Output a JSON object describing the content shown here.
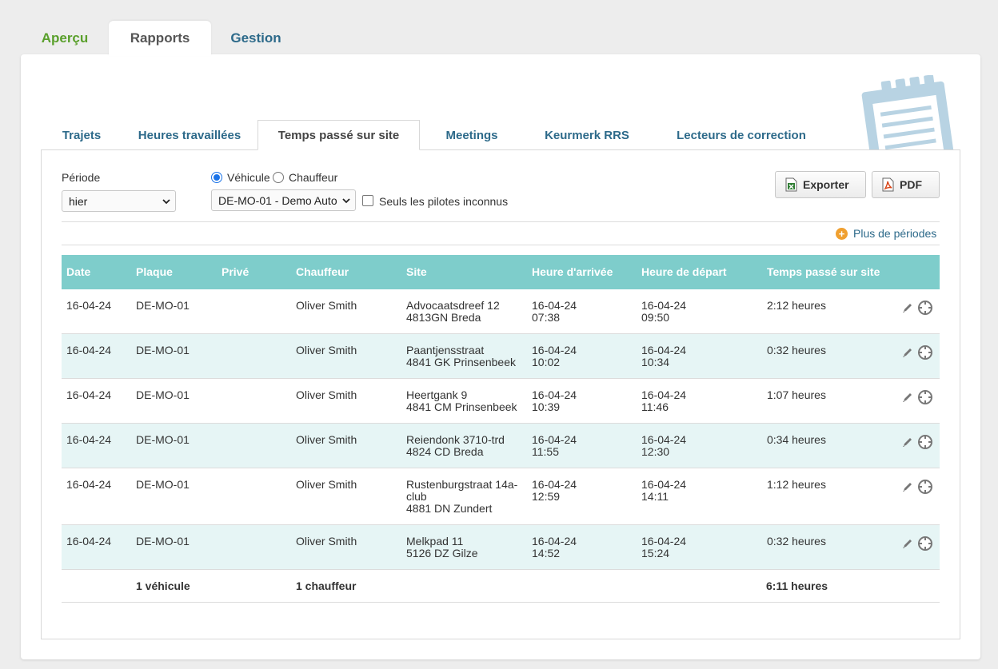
{
  "top_tabs": [
    {
      "label": "Aperçu"
    },
    {
      "label": "Rapports"
    },
    {
      "label": "Gestion"
    }
  ],
  "sub_tabs": [
    {
      "label": "Trajets"
    },
    {
      "label": "Heures travaillées"
    },
    {
      "label": "Temps passé sur site"
    },
    {
      "label": "Meetings"
    },
    {
      "label": "Keurmerk RRS"
    },
    {
      "label": "Lecteurs de correction"
    }
  ],
  "filters": {
    "period_label": "Période",
    "period_value": "hier",
    "radio_vehicle": "Véhicule",
    "radio_driver": "Chauffeur",
    "vehicle_value": "DE-MO-01 - Demo Auto",
    "unknown_drivers_label": "Seuls les pilotes inconnus"
  },
  "buttons": {
    "export": "Exporter",
    "pdf": "PDF"
  },
  "more_periods": "Plus de périodes",
  "table": {
    "headers": [
      "Date",
      "Plaque",
      "Privé",
      "Chauffeur",
      "Site",
      "Heure d'arrivée",
      "Heure de départ",
      "Temps passé sur site"
    ],
    "rows": [
      {
        "date": "16-04-24",
        "plate": "DE-MO-01",
        "private": "",
        "driver": "Oliver Smith",
        "site1": "Advocaatsdreef 12",
        "site2": "4813GN Breda",
        "site3": "",
        "arr_date": "16-04-24",
        "arr_time": "07:38",
        "dep_date": "16-04-24",
        "dep_time": "09:50",
        "duration": "2:12 heures"
      },
      {
        "date": "16-04-24",
        "plate": "DE-MO-01",
        "private": "",
        "driver": "Oliver Smith",
        "site1": "Paantjensstraat",
        "site2": "4841 GK Prinsenbeek",
        "site3": "",
        "arr_date": "16-04-24",
        "arr_time": "10:02",
        "dep_date": "16-04-24",
        "dep_time": "10:34",
        "duration": "0:32 heures"
      },
      {
        "date": "16-04-24",
        "plate": "DE-MO-01",
        "private": "",
        "driver": "Oliver Smith",
        "site1": "Heertgank 9",
        "site2": "4841 CM Prinsenbeek",
        "site3": "",
        "arr_date": "16-04-24",
        "arr_time": "10:39",
        "dep_date": "16-04-24",
        "dep_time": "11:46",
        "duration": "1:07 heures"
      },
      {
        "date": "16-04-24",
        "plate": "DE-MO-01",
        "private": "",
        "driver": "Oliver Smith",
        "site1": "Reiendonk 3710-trd",
        "site2": "4824 CD Breda",
        "site3": "",
        "arr_date": "16-04-24",
        "arr_time": "11:55",
        "dep_date": "16-04-24",
        "dep_time": "12:30",
        "duration": "0:34 heures"
      },
      {
        "date": "16-04-24",
        "plate": "DE-MO-01",
        "private": "",
        "driver": "Oliver Smith",
        "site1": "Rustenburgstraat 14a-",
        "site2": "club",
        "site3": "4881 DN Zundert",
        "arr_date": "16-04-24",
        "arr_time": "12:59",
        "dep_date": "16-04-24",
        "dep_time": "14:11",
        "duration": "1:12 heures"
      },
      {
        "date": "16-04-24",
        "plate": "DE-MO-01",
        "private": "",
        "driver": "Oliver Smith",
        "site1": "Melkpad 11",
        "site2": "5126 DZ Gilze",
        "site3": "",
        "arr_date": "16-04-24",
        "arr_time": "14:52",
        "dep_date": "16-04-24",
        "dep_time": "15:24",
        "duration": "0:32 heures"
      }
    ],
    "footer": {
      "vehicles": "1 véhicule",
      "drivers": "1 chauffeur",
      "total": "6:11 heures"
    }
  },
  "icons": {
    "edit": "pencil-icon",
    "target": "crosshair-icon",
    "excel": "excel-icon",
    "pdf": "pdf-icon",
    "plus": "plus-circle-icon",
    "clipboard": "clipboard-icon"
  },
  "colors": {
    "header_teal": "#7ecdcb",
    "row_alt": "#e6f5f5",
    "link_blue": "#2d6a8a",
    "tab_green": "#5aa02c",
    "plus_orange": "#f0a030"
  }
}
